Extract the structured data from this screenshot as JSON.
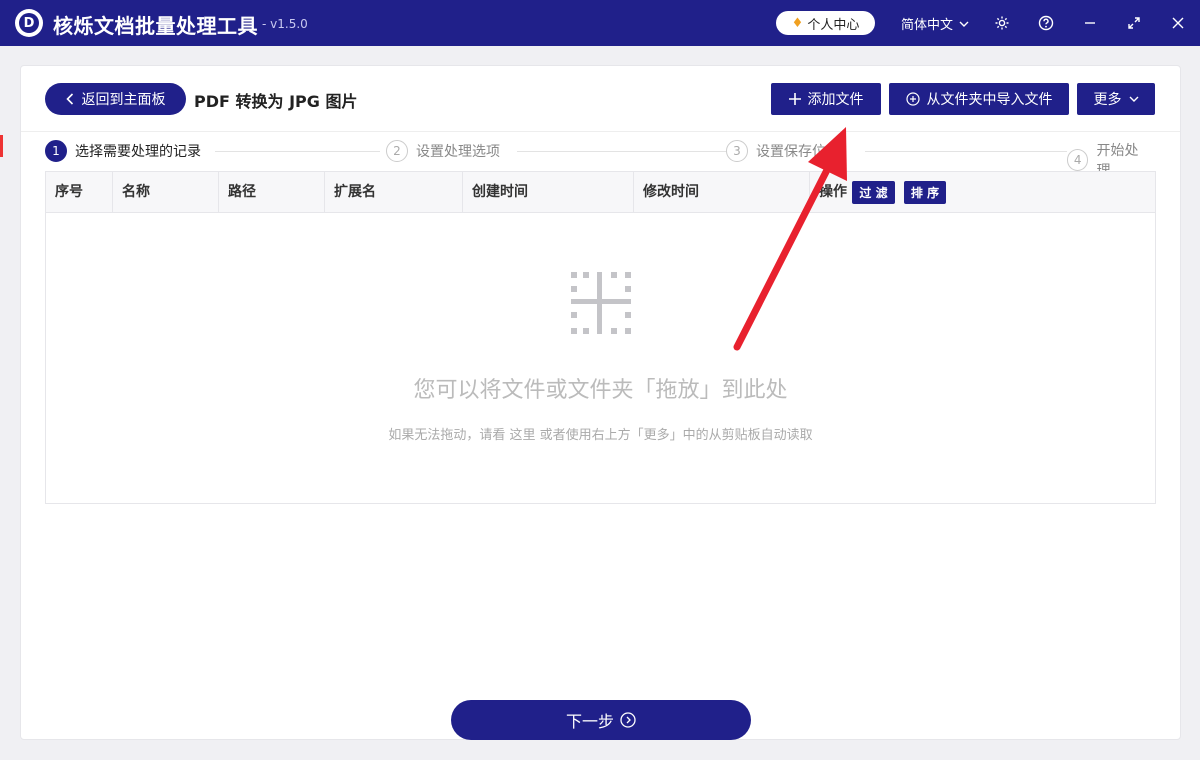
{
  "titlebar": {
    "logo_letter": "D",
    "app_title": "核烁文档批量处理工具",
    "version": "- v1.5.0",
    "profile_label": "个人中心",
    "language": "简体中文"
  },
  "header": {
    "back_label": "返回到主面板",
    "page_title": "PDF 转换为 JPG 图片",
    "add_file_label": "添加文件",
    "import_folder_label": "从文件夹中导入文件",
    "more_label": "更多"
  },
  "steps": [
    {
      "num": "1",
      "label": "选择需要处理的记录"
    },
    {
      "num": "2",
      "label": "设置处理选项"
    },
    {
      "num": "3",
      "label": "设置保存位置"
    },
    {
      "num": "4",
      "label": "开始处理"
    }
  ],
  "table": {
    "columns": [
      "序号",
      "名称",
      "路径",
      "扩展名",
      "创建时间",
      "修改时间",
      "操作"
    ],
    "filter_label": "过 滤",
    "sort_label": "排 序",
    "empty_title": "您可以将文件或文件夹「拖放」到此处",
    "empty_sub": "如果无法拖动，请看  这里  或者使用右上方「更多」中的从剪贴板自动读取"
  },
  "footer": {
    "next_label": "下一步"
  },
  "colors": {
    "primary": "#20208a",
    "annotation_arrow": "#e8212e"
  }
}
